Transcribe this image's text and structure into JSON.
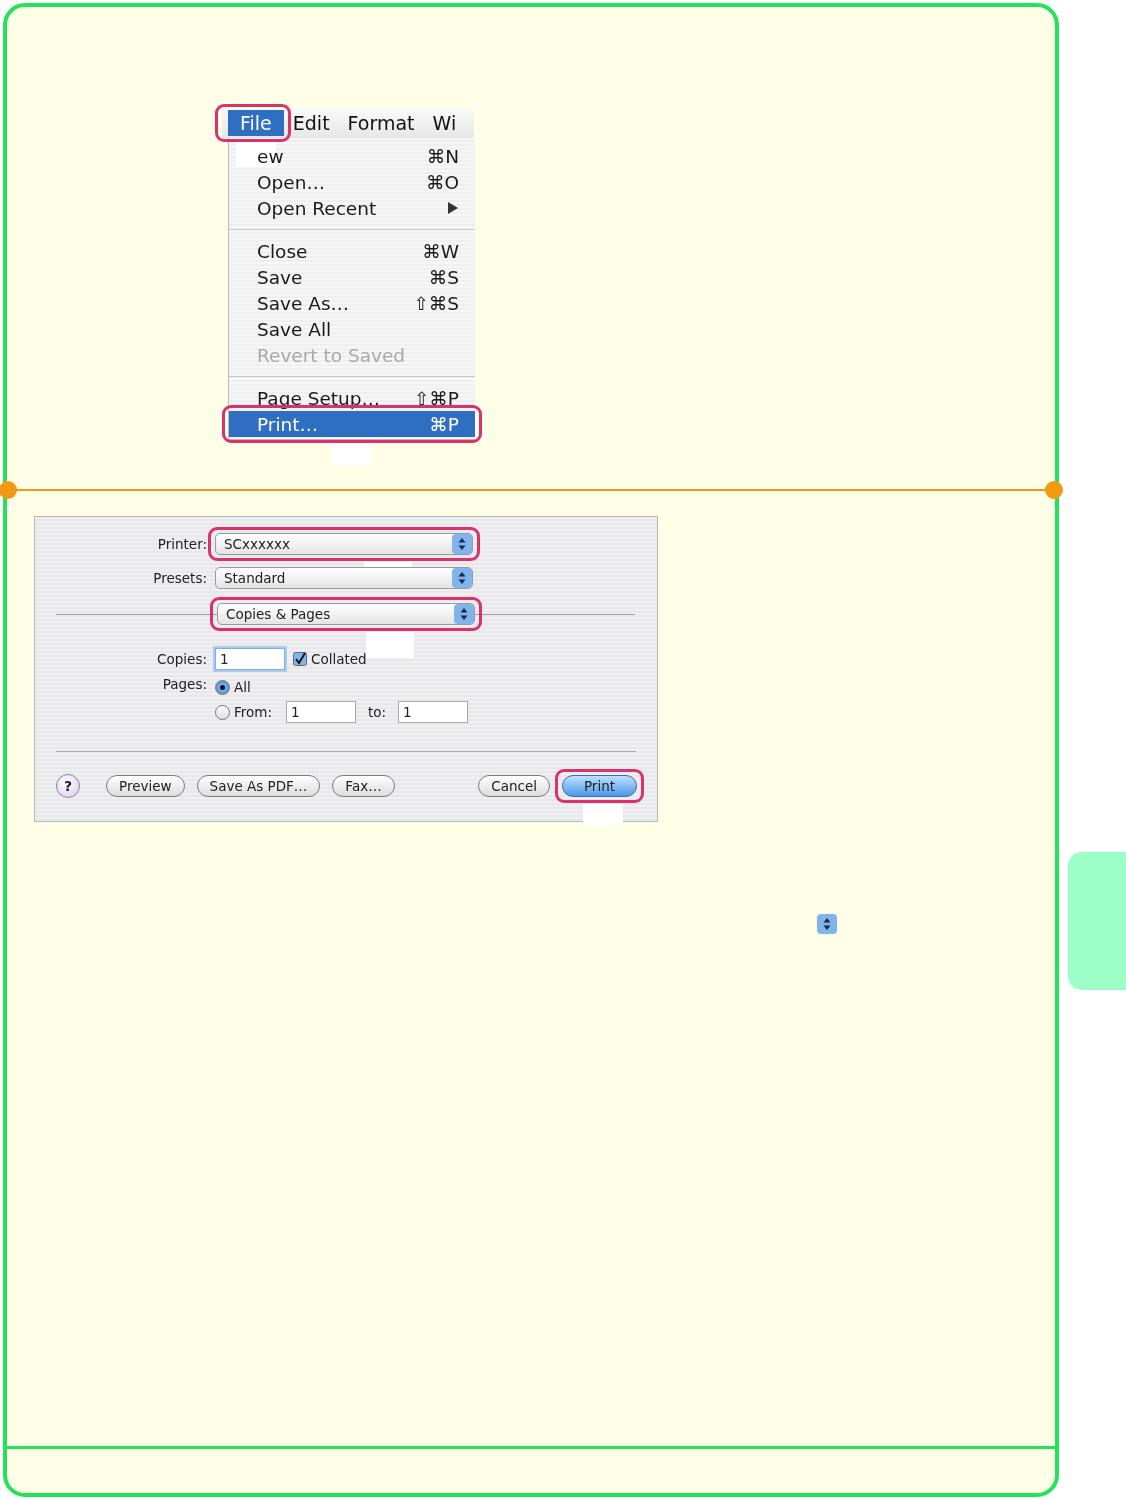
{
  "menu_bar": {
    "items": [
      {
        "label": "File",
        "selected": true,
        "callout": true
      },
      {
        "label": "Edit",
        "selected": false,
        "callout": false
      },
      {
        "label": "Format",
        "selected": false,
        "callout": false
      },
      {
        "label": "Wi",
        "selected": false,
        "callout": false
      }
    ]
  },
  "file_menu": {
    "items": [
      {
        "kind": "item",
        "label": "ew",
        "shortcut": "⌘N",
        "submenu": false,
        "disabled": false,
        "selected": false,
        "callout": false
      },
      {
        "kind": "item",
        "label": "Open…",
        "shortcut": "⌘O",
        "submenu": false,
        "disabled": false,
        "selected": false,
        "callout": false
      },
      {
        "kind": "item",
        "label": "Open Recent",
        "submenu": true,
        "disabled": false,
        "selected": false,
        "callout": false
      },
      {
        "kind": "separator"
      },
      {
        "kind": "item",
        "label": "Close",
        "shortcut": "⌘W",
        "submenu": false,
        "disabled": false,
        "selected": false,
        "callout": false
      },
      {
        "kind": "item",
        "label": "Save",
        "shortcut": "⌘S",
        "submenu": false,
        "disabled": false,
        "selected": false,
        "callout": false
      },
      {
        "kind": "item",
        "label": "Save As…",
        "shortcut": "⇧⌘S",
        "submenu": false,
        "disabled": false,
        "selected": false,
        "callout": false
      },
      {
        "kind": "item",
        "label": "Save All",
        "submenu": false,
        "disabled": false,
        "selected": false,
        "callout": false
      },
      {
        "kind": "item",
        "label": "Revert to Saved",
        "submenu": false,
        "disabled": true,
        "selected": false,
        "callout": false
      },
      {
        "kind": "separator"
      },
      {
        "kind": "item",
        "label": "Page Setup…",
        "shortcut": "⇧⌘P",
        "submenu": false,
        "disabled": false,
        "selected": false,
        "callout": false
      },
      {
        "kind": "item",
        "label": "Print…",
        "shortcut": "⌘P",
        "submenu": false,
        "disabled": false,
        "selected": true,
        "callout": true
      }
    ]
  },
  "print_dialog": {
    "popups": [
      {
        "kind": "popup",
        "label": "Printer:",
        "value": "SCxxxxxx",
        "callout": true
      },
      {
        "kind": "popup",
        "label": "Presets:",
        "value": "Standard",
        "callout": false
      },
      {
        "kind": "panel",
        "value": "Copies & Pages",
        "callout": true
      }
    ],
    "copies": {
      "label": "Copies:",
      "value": "1"
    },
    "collated": {
      "label": "Collated",
      "checked": true
    },
    "pages": {
      "label": "Pages:",
      "options": [
        {
          "label": "All",
          "selected": true
        },
        {
          "label": "From:",
          "selected": false
        }
      ],
      "from": "1",
      "to_label": "to:",
      "to": "1"
    },
    "help": "?",
    "buttons": [
      {
        "label": "Preview",
        "default": false,
        "callout": false
      },
      {
        "label": "Save As PDF…",
        "default": false,
        "callout": false
      },
      {
        "label": "Fax…",
        "default": false,
        "callout": false
      },
      {
        "label": "Cancel",
        "default": false,
        "callout": false
      },
      {
        "label": "Print",
        "default": true,
        "callout": true
      }
    ]
  }
}
